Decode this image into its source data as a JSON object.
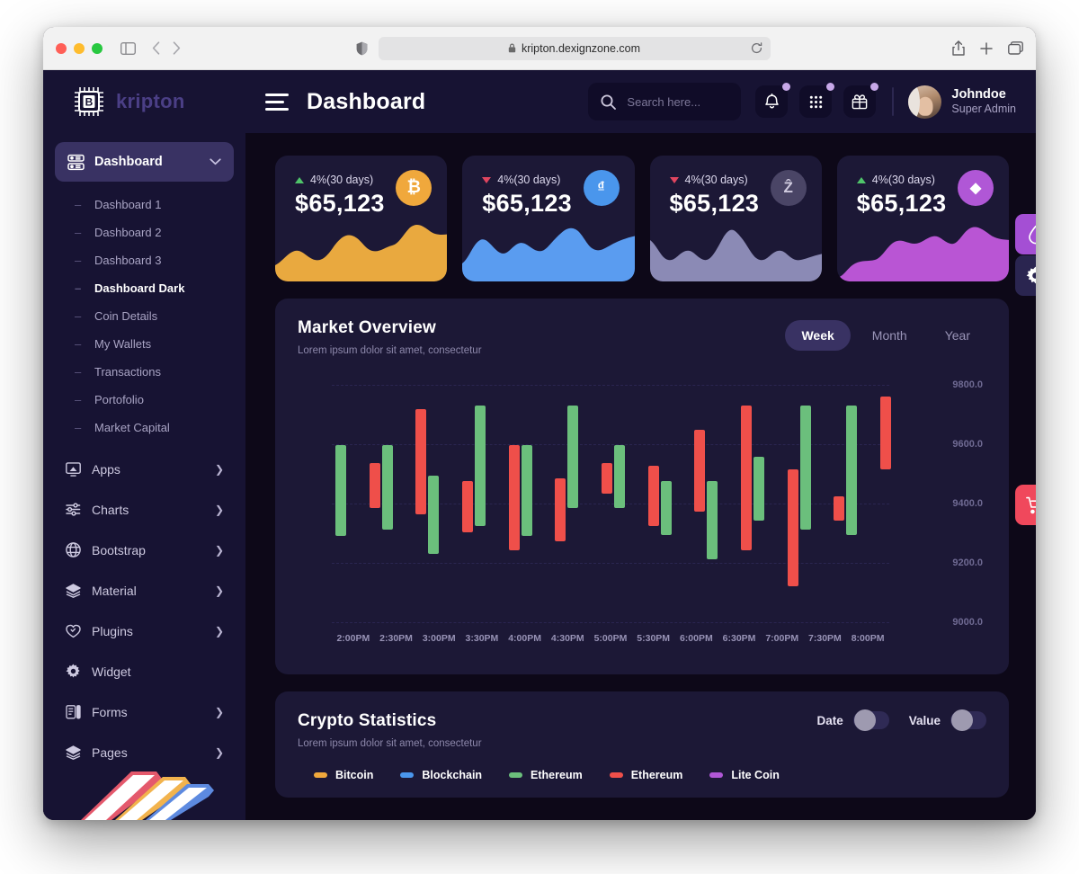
{
  "browser": {
    "url": "kripton.dexignzone.com",
    "lock_icon": "lock-icon",
    "reload_icon": "reload-icon",
    "shield_icon": "shield-icon",
    "sidebar_toggle_icon": "sidebar-toggle-icon",
    "back_icon": "back-arrow-icon",
    "forward_icon": "forward-arrow-icon",
    "share_icon": "share-icon",
    "newtab_icon": "new-tab-icon",
    "tabs_icon": "tab-overview-icon"
  },
  "brand": {
    "name": "kripton",
    "logo_icon": "bitcoin-chip-logo-icon"
  },
  "header": {
    "menu_icon": "hamburger-menu-icon",
    "title": "Dashboard",
    "search": {
      "placeholder": "Search here...",
      "value": "",
      "icon": "search-icon"
    },
    "actions": [
      {
        "name": "notification-button",
        "icon": "bell-icon",
        "badge": true
      },
      {
        "name": "apps-button",
        "icon": "grid-apps-icon",
        "badge": true
      },
      {
        "name": "gift-button",
        "icon": "gift-icon",
        "badge": true
      }
    ],
    "user": {
      "name": "Johndoe",
      "role": "Super Admin",
      "avatar": "user-avatar"
    }
  },
  "sidebar": {
    "active": {
      "label": "Dashboard",
      "icon": "dashboard-icon",
      "chevron": "chevron-down-icon"
    },
    "submenu": [
      {
        "label": "Dashboard  1",
        "active": false
      },
      {
        "label": "Dashboard  2",
        "active": false
      },
      {
        "label": "Dashboard  3",
        "active": false
      },
      {
        "label": "Dashboard Dark",
        "active": true
      },
      {
        "label": "Coin Details",
        "active": false
      },
      {
        "label": "My Wallets",
        "active": false
      },
      {
        "label": "Transactions",
        "active": false
      },
      {
        "label": "Portofolio",
        "active": false
      },
      {
        "label": "Market Capital",
        "active": false
      }
    ],
    "groups": [
      {
        "label": "Apps",
        "icon": "apps-icon",
        "chevron": true
      },
      {
        "label": "Charts",
        "icon": "charts-icon",
        "chevron": true
      },
      {
        "label": "Bootstrap",
        "icon": "bootstrap-globe-icon",
        "chevron": true
      },
      {
        "label": "Material",
        "icon": "layers-icon",
        "chevron": true
      },
      {
        "label": "Plugins",
        "icon": "heart-icon",
        "chevron": true
      },
      {
        "label": "Widget",
        "icon": "widget-gear-icon",
        "chevron": false
      },
      {
        "label": "Forms",
        "icon": "forms-clipboard-icon",
        "chevron": true
      },
      {
        "label": "Pages",
        "icon": "pages-layers-icon",
        "chevron": true
      }
    ],
    "footer_graphic": "folders-illustration"
  },
  "stat_cards": [
    {
      "change": "4%(30 days)",
      "direction": "up",
      "value": "$65,123",
      "coin": "bitcoin",
      "symbol": "₿",
      "coin_bg": "#f0a83c",
      "coin_fg": "#ffffff",
      "spark": "#e9a93f"
    },
    {
      "change": "4%(30 days)",
      "direction": "down",
      "value": "$65,123",
      "coin": "dash",
      "symbol": "D",
      "coin_bg": "#4a96ec",
      "coin_fg": "#ffffff",
      "spark": "#5a9cf0"
    },
    {
      "change": "4%(30 days)",
      "direction": "down",
      "value": "$65,123",
      "coin": "zcash",
      "symbol": "ⓩ",
      "coin_bg": "#4a4566",
      "coin_fg": "#cfcade",
      "spark": "#8b8ab5"
    },
    {
      "change": "4%(30 days)",
      "direction": "up",
      "value": "$65,123",
      "coin": "ethereum",
      "symbol": "♦",
      "coin_bg": "#b057d6",
      "coin_fg": "#ffffff",
      "spark": "#b955d4"
    }
  ],
  "market_overview": {
    "title": "Market Overview",
    "subtitle": "Lorem ipsum dolor sit amet, consectetur",
    "tabs": [
      {
        "label": "Week",
        "active": true
      },
      {
        "label": "Month",
        "active": false
      },
      {
        "label": "Year",
        "active": false
      }
    ]
  },
  "crypto_statistics": {
    "title": "Crypto Statistics",
    "subtitle": "Lorem ipsum dolor sit amet, consectetur",
    "toggles": [
      {
        "label": "Date",
        "on": false
      },
      {
        "label": "Value",
        "on": false
      }
    ],
    "legend": [
      {
        "label": "Bitcoin",
        "color": "#f0a83c"
      },
      {
        "label": "Blockchain",
        "color": "#4a96ec"
      },
      {
        "label": "Ethereum",
        "color": "#6bbf7c"
      },
      {
        "label": "Ethereum",
        "color": "#ef4f4a"
      },
      {
        "label": "Lite Coin",
        "color": "#b057d6"
      }
    ]
  },
  "floating_buttons": [
    {
      "name": "theme-color-button",
      "icon": "droplet-icon",
      "color": "#a44fd4"
    },
    {
      "name": "settings-button",
      "icon": "gear-icon",
      "color": "#2a2550"
    },
    {
      "name": "cart-button",
      "icon": "cart-plus-icon",
      "color": "#f0485c"
    }
  ],
  "chart_data": {
    "type": "candlestick",
    "title": "Market Overview",
    "xlabel": "",
    "ylabel": "",
    "ylim": [
      9000.0,
      9800.0
    ],
    "yticks": [
      "9000.0",
      "9200.0",
      "9400.0",
      "9600.0",
      "9800.0"
    ],
    "grid": true,
    "categories": [
      "2:00PM",
      "2:30PM",
      "3:00PM",
      "3:30PM",
      "4:00PM",
      "4:30PM",
      "5:00PM",
      "5:30PM",
      "6:00PM",
      "6:30PM",
      "7:00PM",
      "7:30PM",
      "8:00PM"
    ],
    "colors": {
      "up": "#6bbf7c",
      "down": "#ef4f4a"
    },
    "candles": [
      {
        "open": 9300,
        "close": 9600,
        "dir": "up"
      },
      {
        "open": 9390,
        "close": 9540,
        "dir": "down"
      },
      {
        "open": 9320,
        "close": 9600,
        "dir": "up"
      },
      {
        "open": 9370,
        "close": 9720,
        "dir": "down"
      },
      {
        "open": 9240,
        "close": 9500,
        "dir": "up"
      },
      {
        "open": 9310,
        "close": 9480,
        "dir": "down"
      },
      {
        "open": 9330,
        "close": 9730,
        "dir": "up"
      },
      {
        "open": 9250,
        "close": 9600,
        "dir": "down"
      },
      {
        "open": 9300,
        "close": 9600,
        "dir": "up"
      },
      {
        "open": 9280,
        "close": 9490,
        "dir": "down"
      },
      {
        "open": 9390,
        "close": 9730,
        "dir": "up"
      },
      {
        "open": 9440,
        "close": 9540,
        "dir": "down"
      },
      {
        "open": 9390,
        "close": 9600,
        "dir": "up"
      },
      {
        "open": 9330,
        "close": 9530,
        "dir": "down"
      },
      {
        "open": 9300,
        "close": 9480,
        "dir": "up"
      },
      {
        "open": 9380,
        "close": 9650,
        "dir": "down"
      },
      {
        "open": 9220,
        "close": 9480,
        "dir": "up"
      },
      {
        "open": 9250,
        "close": 9730,
        "dir": "down"
      },
      {
        "open": 9350,
        "close": 9560,
        "dir": "up"
      },
      {
        "open": 9130,
        "close": 9520,
        "dir": "down"
      },
      {
        "open": 9320,
        "close": 9730,
        "dir": "up"
      },
      {
        "open": 9350,
        "close": 9430,
        "dir": "down"
      },
      {
        "open": 9300,
        "close": 9730,
        "dir": "up"
      },
      {
        "open": 9520,
        "close": 9760,
        "dir": "down"
      }
    ]
  }
}
